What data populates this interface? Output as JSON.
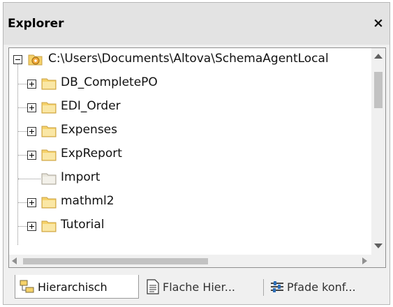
{
  "window": {
    "title": "Explorer",
    "close_label": "×"
  },
  "tree": {
    "root": {
      "label": "C:\\Users\\Documents\\Altova\\SchemaAgentLocal",
      "expanded": true,
      "icon": "gear-folder-icon"
    },
    "items": [
      {
        "label": "DB_CompletePO",
        "has_children": true
      },
      {
        "label": "EDI_Order",
        "has_children": true
      },
      {
        "label": "Expenses",
        "has_children": true
      },
      {
        "label": "ExpReport",
        "has_children": true
      },
      {
        "label": "Import",
        "has_children": false
      },
      {
        "label": "mathml2",
        "has_children": true
      },
      {
        "label": "Tutorial",
        "has_children": true
      }
    ]
  },
  "tabs": [
    {
      "label": "Hierarchisch",
      "icon": "hierarchy-icon",
      "active": true
    },
    {
      "label": "Flache Hier...",
      "icon": "document-list-icon",
      "active": false
    },
    {
      "label": "Pfade konf...",
      "icon": "path-config-icon",
      "active": false
    }
  ],
  "colors": {
    "folder": "#f6d26a",
    "folder_edge": "#c8a043",
    "panel_bg": "#f0f0f0",
    "title_bg": "#e3e3e3"
  }
}
